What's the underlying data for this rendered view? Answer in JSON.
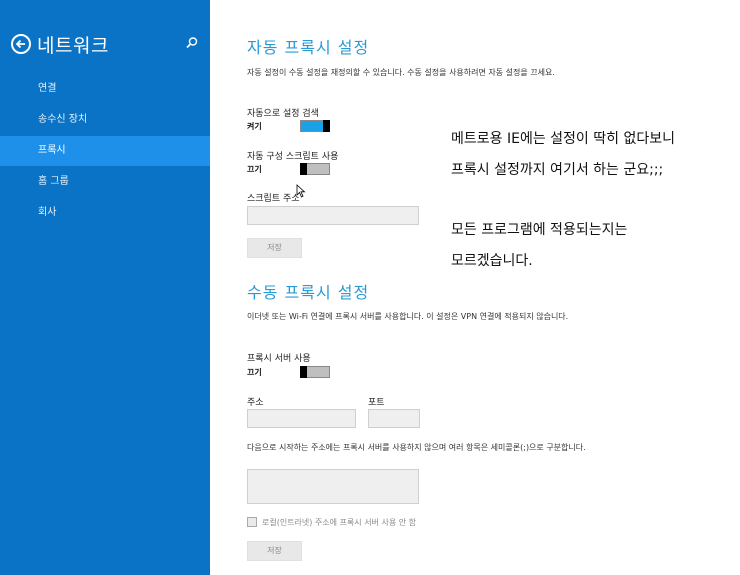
{
  "sidebar": {
    "title": "네트워크",
    "items": [
      {
        "label": "연결"
      },
      {
        "label": "송수신 장치"
      },
      {
        "label": "프록시"
      },
      {
        "label": "홈 그룹"
      },
      {
        "label": "회사"
      }
    ],
    "active_index": 2
  },
  "auto_proxy": {
    "title": "자동 프록시 설정",
    "description": "자동 설정이 수동 설정을 재정의할 수 있습니다. 수동 설정을 사용하려면 자동 설정을 끄세요.",
    "detect_label": "자동으로 설정 검색",
    "detect_state": "켜기",
    "detect_on": true,
    "script_label": "자동 구성 스크립트 사용",
    "script_state": "끄기",
    "script_on": false,
    "address_label": "스크립트 주소",
    "address_value": "",
    "save_label": "저장"
  },
  "manual_proxy": {
    "title": "수동 프록시 설정",
    "description": "이더넷 또는 Wi-Fi 연결에 프록시 서버를 사용합니다. 이 설정은 VPN 연결에 적용되지 않습니다.",
    "server_label": "프록시 서버 사용",
    "server_state": "끄기",
    "server_on": false,
    "address_label": "주소",
    "port_label": "포트",
    "address_value": "",
    "port_value": "",
    "exceptions_label": "다음으로 시작하는 주소에는 프록시 서버를 사용하지 않으며 여러 항목은 세미콜론(;)으로 구분합니다.",
    "exceptions_value": "",
    "local_bypass_label": "로컬(인트라넷) 주소에 프록시 서버 사용 안 함",
    "save_label": "저장"
  },
  "annotation": {
    "line1": "메트로용 IE에는 설정이 딱히 없다보니",
    "line2": "프록시 설정까지 여기서 하는 군요;;;",
    "line3": "모든 프로그램에 적용되는지는",
    "line4": "모르겠습니다."
  },
  "colors": {
    "sidebar_bg": "#0a73c5",
    "sidebar_active": "#1e90ea",
    "accent": "#2a9ad6",
    "toggle_on": "#1aa1e6"
  }
}
